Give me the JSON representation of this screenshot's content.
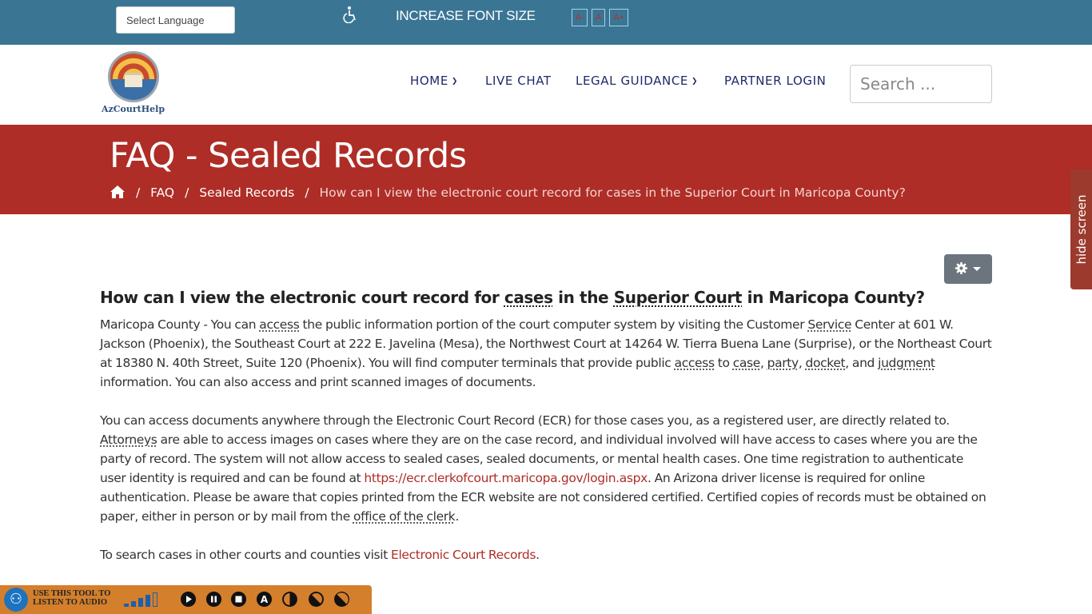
{
  "topbar": {
    "language_select": "Select Language",
    "accessibility_icon": "wheelchair-icon",
    "font_size_label": "INCREASE FONT SIZE",
    "font_buttons": [
      "A-",
      "A",
      "A+"
    ],
    "bg_color": "#3a7694"
  },
  "header": {
    "logo_text": "AzCourtHelp",
    "nav": [
      {
        "label": "HOME",
        "has_dropdown": true
      },
      {
        "label": "LIVE CHAT",
        "has_dropdown": false
      },
      {
        "label": "LEGAL GUIDANCE",
        "has_dropdown": true
      },
      {
        "label": "PARTNER LOGIN",
        "has_dropdown": false
      }
    ],
    "search_placeholder": "Search ..."
  },
  "banner": {
    "title": "FAQ - Sealed Records",
    "breadcrumb": [
      {
        "label": "home-icon"
      },
      {
        "label": "FAQ"
      },
      {
        "label": "Sealed Records"
      },
      {
        "label": "How can I view the electronic court record for cases in the Superior Court in Maricopa County?"
      }
    ],
    "bg_color": "#ae2d26"
  },
  "side_tab": {
    "label": "hide screen"
  },
  "tools_button": {
    "icon": "gear-icon"
  },
  "article": {
    "title_parts": [
      "How can I view the electronic court record for ",
      "cases",
      " in the ",
      "Superior Court",
      " in Maricopa County?"
    ],
    "p1": {
      "t1": "Maricopa County - You can ",
      "a1": "access",
      "t2": " the public information portion of the court computer system by visiting the Customer ",
      "a2": "Service",
      "t3": " Center at 601 W. Jackson (Phoenix), the Southeast Court at 222 E. Javelina (Mesa), the Northwest Court at 14264 W. Tierra Buena Lane (Surprise), or the Northeast Court at 18380 N. 40th Street, Suite 120 (Phoenix). You will find computer terminals that provide public ",
      "a3": "access",
      "t4": " to ",
      "a4": "case",
      "t5": ", ",
      "a5": "party",
      "t6": ", ",
      "a6": "docket",
      "t7": ", and ",
      "a7": "judgment",
      "t8": " information. You can also access and print scanned images of documents."
    },
    "p2": {
      "t1": "You can access documents anywhere through the Electronic Court Record (ECR) for those cases you, as a registered user, are directly related to. ",
      "a1": "Attorneys",
      "t2": " are able to access images on cases where they are on the case record, and individual involved will have access to cases where you are the party of record. The system will not allow access to sealed cases, sealed documents, or mental health cases. One time registration to authenticate user identity is required and can be found at ",
      "link": "https://ecr.clerkofcourt.maricopa.gov/login.aspx",
      "t3": ". An Arizona driver license is required for online authentication. Please be aware that copies printed from the ECR website are not considered certified. Certified copies of records must be obtained on paper, either in person or by mail from the ",
      "a2": "office of the clerk",
      "t4": "."
    },
    "p3": {
      "t1": "To search cases in other courts and counties visit ",
      "link": "Electronic Court Records",
      "t2": "."
    },
    "link_color": "#ae2d26"
  },
  "audio_toolbar": {
    "label_line1": "USE THIS TOOL TO",
    "label_line2": "LISTEN TO AUDIO",
    "volume_level": 0.75,
    "buttons": [
      "play-icon",
      "pause-icon",
      "stop-icon",
      "text-icon",
      "contrast-icon",
      "invert-icon",
      "grayscale-icon"
    ],
    "bg_color": "#d37f2c"
  }
}
